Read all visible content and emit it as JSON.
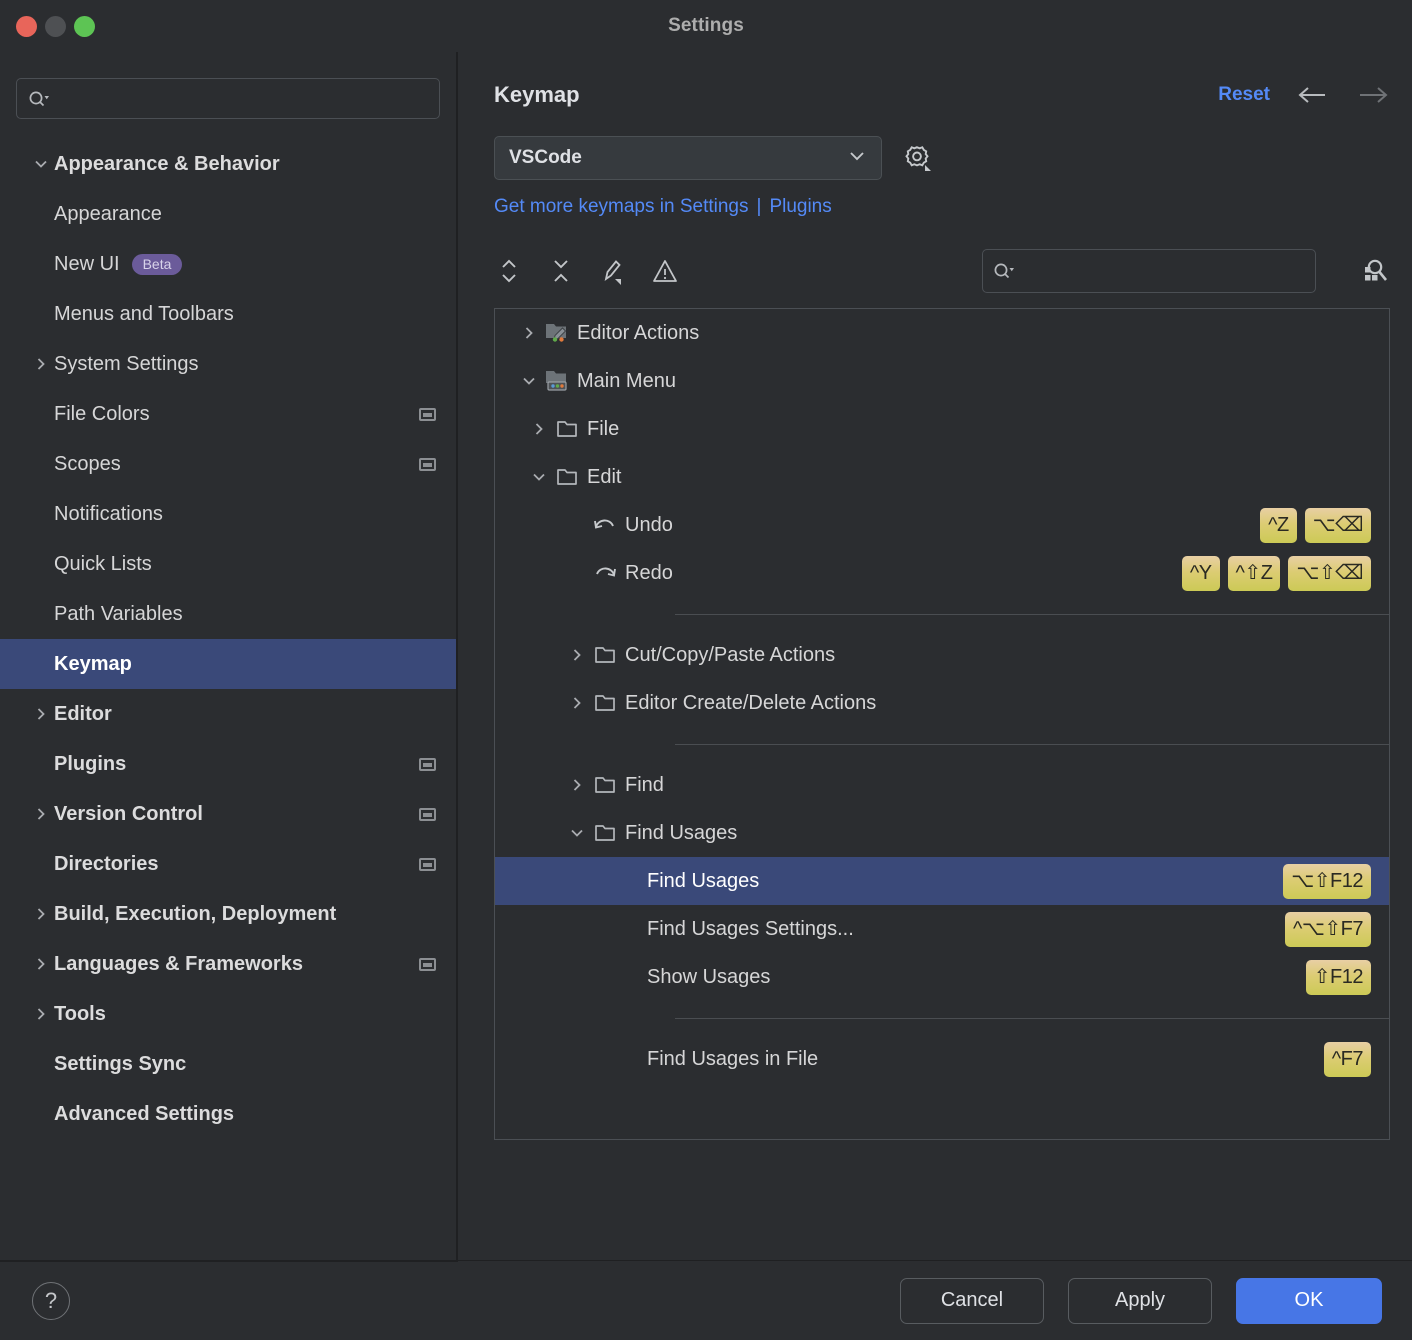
{
  "window": {
    "title": "Settings",
    "traffic_lights": [
      "close-red",
      "minimize-yellow",
      "zoom-green"
    ]
  },
  "sidebar": {
    "search": {
      "value": "",
      "placeholder": ""
    },
    "items": [
      {
        "label": "Appearance & Behavior",
        "level": 0,
        "bold": true,
        "arrow": "down",
        "selected": false,
        "ext": false
      },
      {
        "label": "Appearance",
        "level": 1,
        "bold": false,
        "arrow": "none",
        "selected": false,
        "ext": false
      },
      {
        "label": "New UI",
        "level": 1,
        "bold": false,
        "arrow": "none",
        "selected": false,
        "ext": false,
        "badge": "Beta"
      },
      {
        "label": "Menus and Toolbars",
        "level": 1,
        "bold": false,
        "arrow": "none",
        "selected": false,
        "ext": false
      },
      {
        "label": "System Settings",
        "level": 1,
        "bold": false,
        "arrow": "right",
        "selected": false,
        "ext": false
      },
      {
        "label": "File Colors",
        "level": 1,
        "bold": false,
        "arrow": "none",
        "selected": false,
        "ext": true
      },
      {
        "label": "Scopes",
        "level": 1,
        "bold": false,
        "arrow": "none",
        "selected": false,
        "ext": true
      },
      {
        "label": "Notifications",
        "level": 1,
        "bold": false,
        "arrow": "none",
        "selected": false,
        "ext": false
      },
      {
        "label": "Quick Lists",
        "level": 1,
        "bold": false,
        "arrow": "none",
        "selected": false,
        "ext": false
      },
      {
        "label": "Path Variables",
        "level": 1,
        "bold": false,
        "arrow": "none",
        "selected": false,
        "ext": false
      },
      {
        "label": "Keymap",
        "level": 0,
        "bold": true,
        "arrow": "none",
        "selected": true,
        "ext": false
      },
      {
        "label": "Editor",
        "level": 0,
        "bold": true,
        "arrow": "right",
        "selected": false,
        "ext": false
      },
      {
        "label": "Plugins",
        "level": 0,
        "bold": true,
        "arrow": "none",
        "selected": false,
        "ext": true
      },
      {
        "label": "Version Control",
        "level": 0,
        "bold": true,
        "arrow": "right",
        "selected": false,
        "ext": true
      },
      {
        "label": "Directories",
        "level": 0,
        "bold": true,
        "arrow": "none",
        "selected": false,
        "ext": true
      },
      {
        "label": "Build, Execution, Deployment",
        "level": 0,
        "bold": true,
        "arrow": "right",
        "selected": false,
        "ext": false
      },
      {
        "label": "Languages & Frameworks",
        "level": 0,
        "bold": true,
        "arrow": "right",
        "selected": false,
        "ext": true
      },
      {
        "label": "Tools",
        "level": 0,
        "bold": true,
        "arrow": "right",
        "selected": false,
        "ext": false
      },
      {
        "label": "Settings Sync",
        "level": 0,
        "bold": true,
        "arrow": "none",
        "selected": false,
        "ext": false
      },
      {
        "label": "Advanced Settings",
        "level": 0,
        "bold": true,
        "arrow": "none",
        "selected": false,
        "ext": false
      }
    ]
  },
  "main": {
    "page_title": "Keymap",
    "reset_label": "Reset",
    "keymap_select": {
      "value": "VSCode"
    },
    "links": {
      "get_more": "Get more keymaps in Settings",
      "separator": "|",
      "plugins": "Plugins"
    },
    "tree_search": {
      "value": "",
      "placeholder": ""
    },
    "toolbar_icons": [
      "expand-collapse-icon",
      "collapse-all-icon",
      "edit-shortcut-icon",
      "warning-icon"
    ],
    "filter_icon": "find-by-shortcut-icon",
    "tree": [
      {
        "label": "Editor Actions",
        "level": 0,
        "arrow": "right",
        "icon": "editor-actions-folder-icon",
        "shortcuts": [],
        "selected": false,
        "sep_after": false
      },
      {
        "label": "Main Menu",
        "level": 0,
        "arrow": "down",
        "icon": "main-menu-folder-icon",
        "shortcuts": [],
        "selected": false,
        "sep_after": false
      },
      {
        "label": "File",
        "level": 1,
        "arrow": "right",
        "icon": "folder-icon",
        "shortcuts": [],
        "selected": false,
        "sep_after": false
      },
      {
        "label": "Edit",
        "level": 1,
        "arrow": "down",
        "icon": "folder-icon",
        "shortcuts": [],
        "selected": false,
        "sep_after": false
      },
      {
        "label": "Undo",
        "level": 2,
        "arrow": "none",
        "icon": "undo-icon",
        "shortcuts": [
          "^Z",
          "⌥⌫"
        ],
        "selected": false,
        "sep_after": false
      },
      {
        "label": "Redo",
        "level": 2,
        "arrow": "none",
        "icon": "redo-icon",
        "shortcuts": [
          "^Y",
          "^⇧Z",
          "⌥⇧⌫"
        ],
        "selected": false,
        "sep_after": true
      },
      {
        "label": "Cut/Copy/Paste Actions",
        "level": 2,
        "arrow": "right",
        "icon": "folder-icon",
        "shortcuts": [],
        "selected": false,
        "sep_after": false
      },
      {
        "label": "Editor Create/Delete Actions",
        "level": 2,
        "arrow": "right",
        "icon": "folder-icon",
        "shortcuts": [],
        "selected": false,
        "sep_after": true
      },
      {
        "label": "Find",
        "level": 2,
        "arrow": "right",
        "icon": "folder-icon",
        "shortcuts": [],
        "selected": false,
        "sep_after": false
      },
      {
        "label": "Find Usages",
        "level": 2,
        "arrow": "down",
        "icon": "folder-icon",
        "shortcuts": [],
        "selected": false,
        "sep_after": false
      },
      {
        "label": "Find Usages",
        "level": 3,
        "arrow": "none",
        "icon": "none",
        "shortcuts": [
          "⌥⇧F12"
        ],
        "selected": true,
        "sep_after": false
      },
      {
        "label": "Find Usages Settings...",
        "level": 3,
        "arrow": "none",
        "icon": "none",
        "shortcuts": [
          "^⌥⇧F7"
        ],
        "selected": false,
        "sep_after": false
      },
      {
        "label": "Show Usages",
        "level": 3,
        "arrow": "none",
        "icon": "none",
        "shortcuts": [
          "⇧F12"
        ],
        "selected": false,
        "sep_after": true
      },
      {
        "label": "Find Usages in File",
        "level": 3,
        "arrow": "none",
        "icon": "none",
        "shortcuts": [
          "^F7"
        ],
        "selected": false,
        "sep_after": false
      }
    ]
  },
  "footer": {
    "help_label": "?",
    "cancel_label": "Cancel",
    "apply_label": "Apply",
    "ok_label": "OK"
  },
  "colors": {
    "background": "#2b2d30",
    "selection": "#3a4979",
    "accent_link": "#548af7",
    "primary_button": "#4776e6",
    "shortcut_badge": "#dccc73",
    "beta_badge": "#6b5b9a"
  }
}
